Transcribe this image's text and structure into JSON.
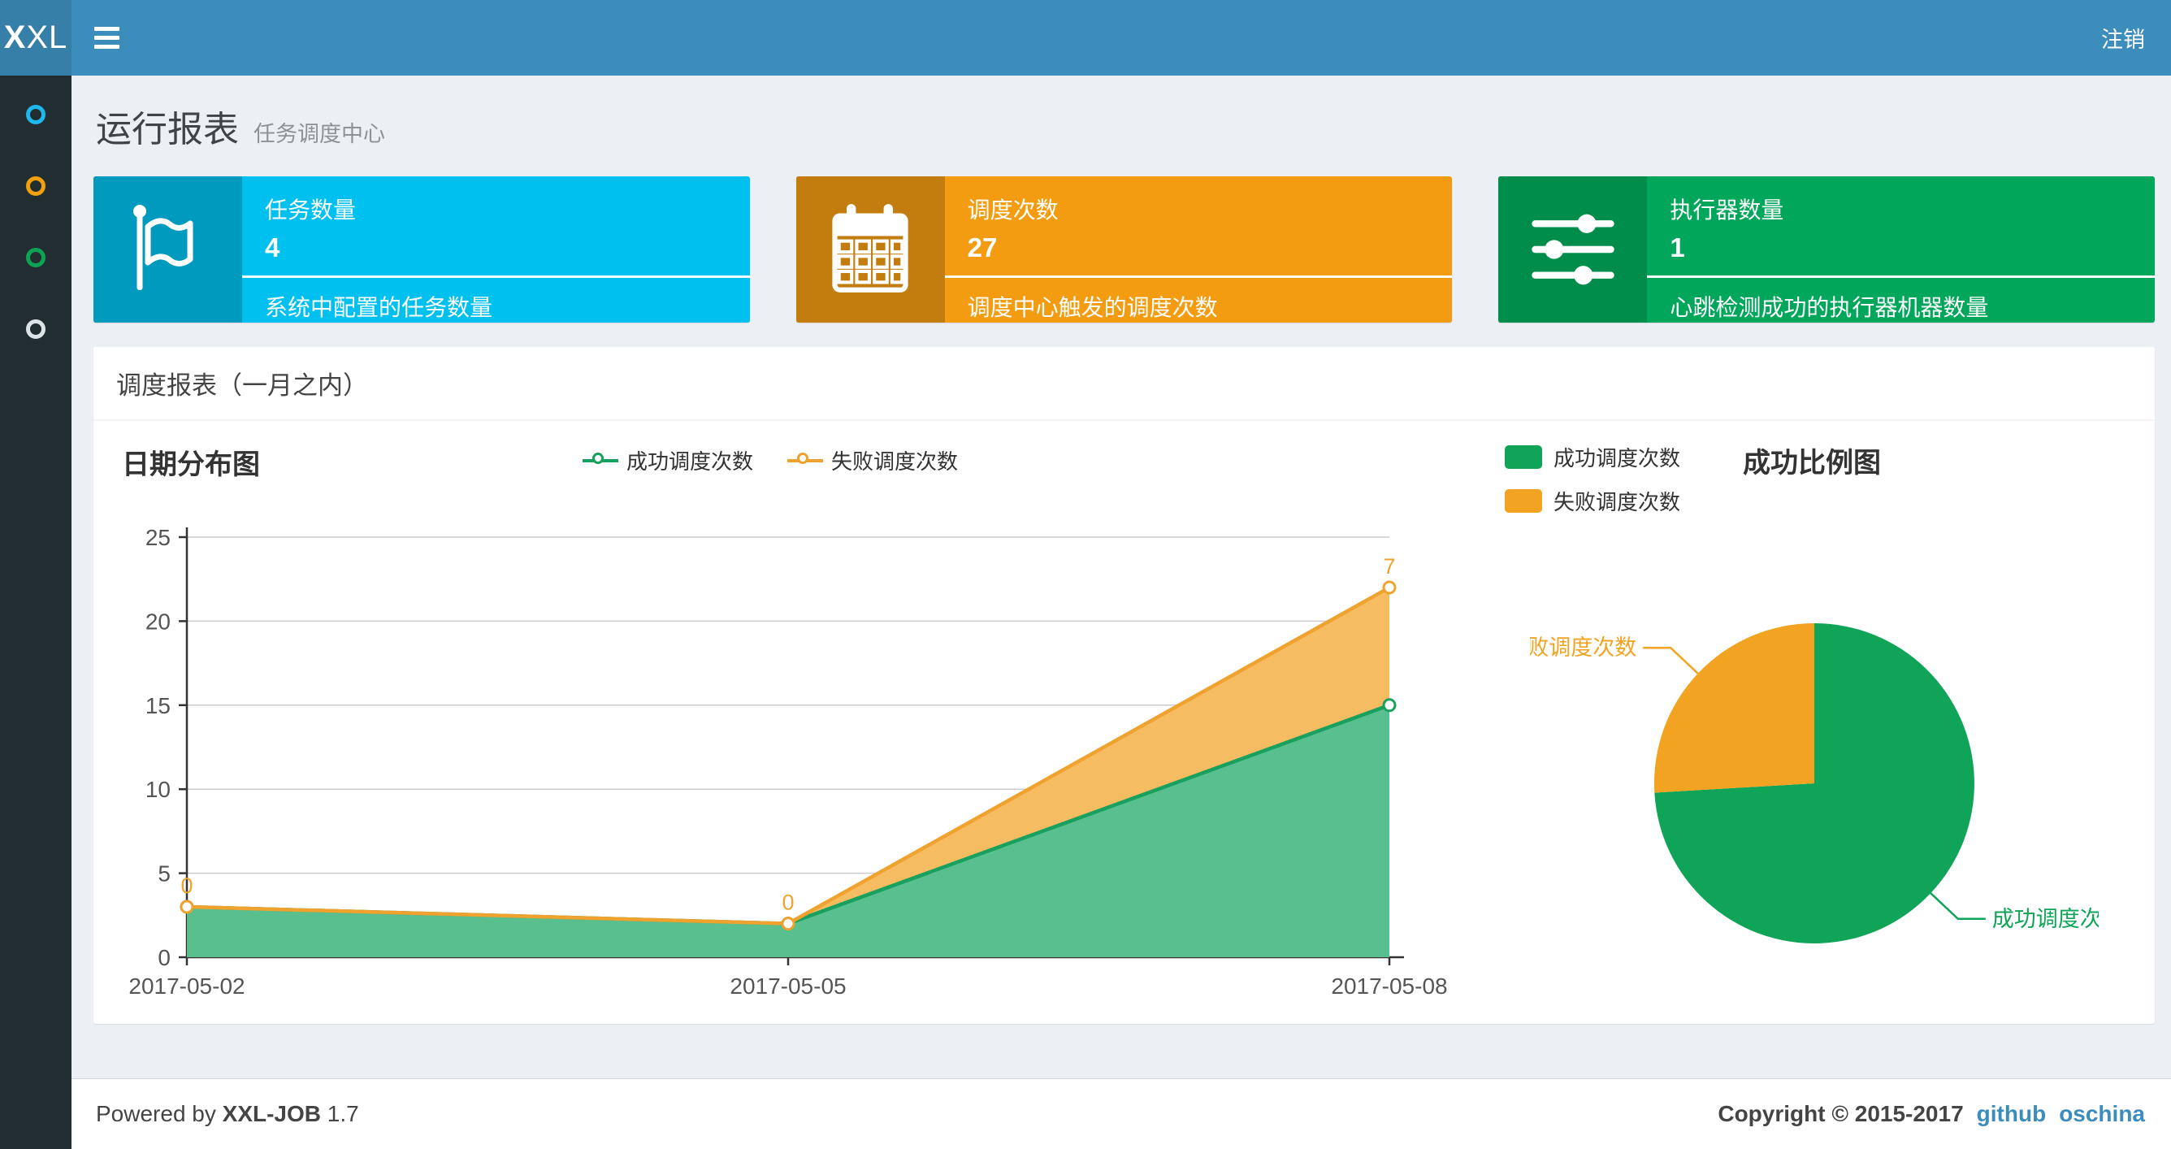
{
  "header": {
    "logo_bold": "X",
    "logo_rest": "XL",
    "logout_label": "注销",
    "bg_color": "#3c8dbc",
    "logo_bg_color": "#367fa9"
  },
  "sidebar": {
    "bg_color": "#222d32",
    "items": [
      {
        "icon": "circle-icon",
        "color": "#1eb8ec"
      },
      {
        "icon": "circle-icon",
        "color": "#f0a10c"
      },
      {
        "icon": "circle-icon",
        "color": "#0ea353"
      },
      {
        "icon": "circle-icon",
        "color": "#dde3e6"
      }
    ]
  },
  "page": {
    "title": "运行报表",
    "subtitle": "任务调度中心"
  },
  "stat_cards": [
    {
      "icon": "flag-icon",
      "label": "任务数量",
      "value": "4",
      "description": "系统中配置的任务数量",
      "bg": "#00c0ef",
      "icon_bg": "#009abf"
    },
    {
      "icon": "calendar-icon",
      "label": "调度次数",
      "value": "27",
      "description": "调度中心触发的调度次数",
      "bg": "#f39c12",
      "icon_bg": "#c27d0e"
    },
    {
      "icon": "sliders-icon",
      "label": "执行器数量",
      "value": "1",
      "description": "心跳检测成功的执行器机器数量",
      "bg": "#00a65a",
      "icon_bg": "#008d4c"
    }
  ],
  "panel": {
    "title": "调度报表（一月之内）"
  },
  "chart_data": [
    {
      "type": "area",
      "title": "日期分布图",
      "x": [
        "2017-05-02",
        "2017-05-05",
        "2017-05-08"
      ],
      "stacked": true,
      "series": [
        {
          "name": "成功调度次数",
          "values": [
            3,
            2,
            15
          ],
          "color": "#17a05e",
          "area_color": "#5abf8e"
        },
        {
          "name": "失败调度次数",
          "values": [
            0,
            0,
            7
          ],
          "color": "#f0a22f",
          "area_color": "#f6bc62"
        }
      ],
      "point_labels_series": 1,
      "point_labels": [
        "0",
        "0",
        "7"
      ],
      "ylim": [
        0,
        25
      ],
      "yticks": [
        0,
        5,
        10,
        15,
        20,
        25
      ],
      "grid": "horizontal",
      "legend_position": "top",
      "axis_color": "#333333",
      "grid_color": "#cccccc",
      "tick_label_color": "#555555"
    },
    {
      "type": "pie",
      "title": "成功比例图",
      "slices": [
        {
          "label": "成功调度次数",
          "value": 20,
          "color": "#0fa457"
        },
        {
          "label": "失败调度次数",
          "value": 7,
          "color": "#f2a321"
        }
      ],
      "legend_position": "top-left",
      "start_angle_deg": -90,
      "clockwise": true
    }
  ],
  "footer": {
    "powered_prefix": "Powered by",
    "powered_brand": "XXL-JOB",
    "powered_version": "1.7",
    "copyright": "Copyright © 2015-2017",
    "links": [
      {
        "label": "github"
      },
      {
        "label": "oschina"
      }
    ],
    "link_color": "#3c8dbc"
  }
}
